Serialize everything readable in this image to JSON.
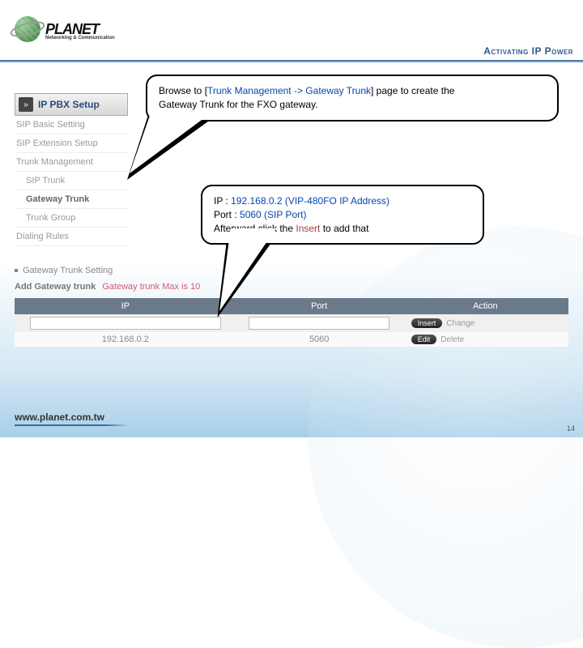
{
  "header": {
    "logo_text": "PLANET",
    "logo_sub": "Networking & Communication",
    "tagline": "Activating IP Power"
  },
  "sidebar": {
    "title": "IP PBX Setup",
    "items": [
      {
        "label": "SIP Basic Setting",
        "indent": false,
        "active": false
      },
      {
        "label": "SIP Extension Setup",
        "indent": false,
        "active": false
      },
      {
        "label": "Trunk Management",
        "indent": false,
        "active": false
      },
      {
        "label": "SIP Trunk",
        "indent": true,
        "active": false
      },
      {
        "label": "Gateway Trunk",
        "indent": true,
        "active": true
      },
      {
        "label": "Trunk Group",
        "indent": true,
        "active": false
      },
      {
        "label": "Dialing Rules",
        "indent": false,
        "active": false
      }
    ]
  },
  "callout1": {
    "pre": "Browse to [",
    "link": "Trunk Management -> Gateway Trunk",
    "post1": "] page to create the",
    "line2": "Gateway Trunk for the FXO gateway."
  },
  "callout2": {
    "l1a": "IP : ",
    "l1b": "192.168.0.2 (VIP-480FO IP Address)",
    "l2a": "Port : ",
    "l2b": "5060 (SIP Port)",
    "l3a": "Afterward click the ",
    "l3b": "Insert",
    "l3c": " to add that"
  },
  "content": {
    "section_label": "Gateway Trunk Setting",
    "add_label": "Add Gateway trunk",
    "max_note": "Gateway trunk Max is 10",
    "columns": {
      "ip": "IP",
      "port": "Port",
      "action": "Action"
    },
    "rows": [
      {
        "ip": "",
        "port": "",
        "actions": [
          {
            "label": "Insert",
            "type": "pill"
          },
          {
            "label": "Change",
            "type": "plain"
          }
        ]
      },
      {
        "ip": "192.168.0.2",
        "port": "5060",
        "actions": [
          {
            "label": "Edit",
            "type": "pill"
          },
          {
            "label": "Delete",
            "type": "plain"
          }
        ]
      }
    ]
  },
  "footer": {
    "url": "www.planet.com.tw",
    "slide": "14"
  }
}
